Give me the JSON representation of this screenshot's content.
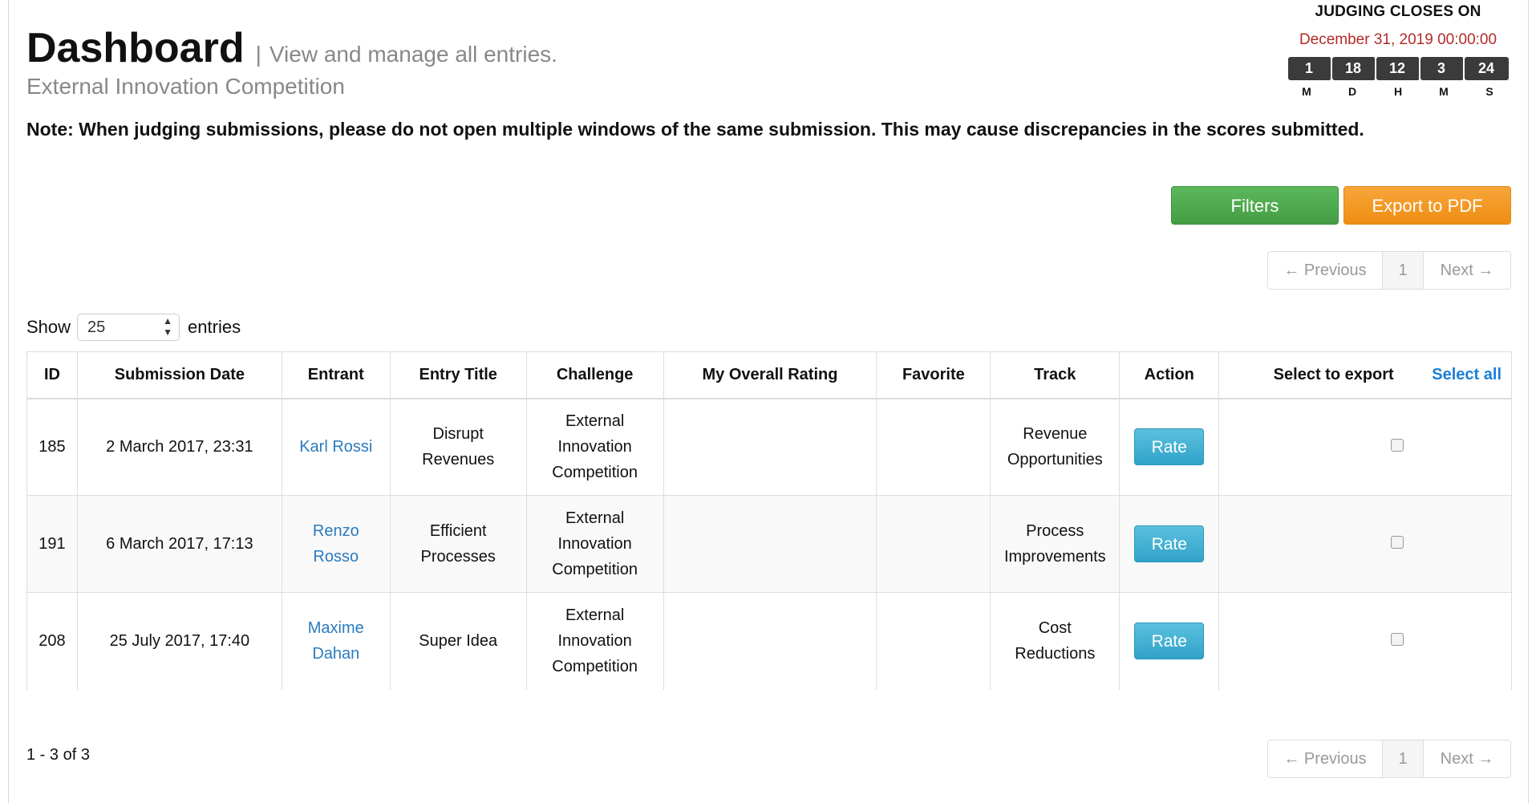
{
  "header": {
    "title": "Dashboard",
    "separator": "|",
    "subtitle": "View and manage all entries.",
    "competition": "External Innovation Competition"
  },
  "countdown": {
    "title": "JUDGING CLOSES ON",
    "date": "December 31, 2019 00:00:00",
    "values": [
      "1",
      "18",
      "12",
      "3",
      "24"
    ],
    "units": [
      "M",
      "D",
      "H",
      "M",
      "S"
    ],
    "date_color": "#b22b27"
  },
  "note": "Note: When judging submissions, please do not open multiple windows of the same submission. This may cause discrepancies in the scores submitted.",
  "toolbar": {
    "filters_label": "Filters",
    "export_label": "Export to PDF"
  },
  "pagination": {
    "previous": "← Previous",
    "page": "1",
    "next": "Next →"
  },
  "length_menu": {
    "show": "Show",
    "value": "25",
    "entries": "entries"
  },
  "table": {
    "columns": [
      "ID",
      "Submission Date",
      "Entrant",
      "Entry Title",
      "Challenge",
      "My Overall Rating",
      "Favorite",
      "Track",
      "Action",
      "Select to export"
    ],
    "select_all": "Select all",
    "rows": [
      {
        "id": "185",
        "date": "2 March 2017, 23:31",
        "entrant": "Karl Rossi",
        "title": "Disrupt Revenues",
        "challenge": "External Innovation Competition",
        "rating": "",
        "favorite": "",
        "track": "Revenue Opportunities",
        "action": "Rate"
      },
      {
        "id": "191",
        "date": "6 March 2017, 17:13",
        "entrant": "Renzo Rosso",
        "title": "Efficient Processes",
        "challenge": "External Innovation Competition",
        "rating": "",
        "favorite": "",
        "track": "Process Improvements",
        "action": "Rate"
      },
      {
        "id": "208",
        "date": "25 July 2017, 17:40",
        "entrant": "Maxime Dahan",
        "title": "Super Idea",
        "challenge": "External Innovation Competition",
        "rating": "",
        "favorite": "",
        "track": "Cost Reductions",
        "action": "Rate"
      }
    ]
  },
  "footer": {
    "record_count": "1 - 3 of 3"
  },
  "colors": {
    "filters": "#5cb85c",
    "export": "#f0931e",
    "rate": "#39acd3",
    "link": "#2a7bbf"
  },
  "icons": {
    "select_arrows": "updown-arrows-icon",
    "checkbox": "checkbox-icon"
  }
}
